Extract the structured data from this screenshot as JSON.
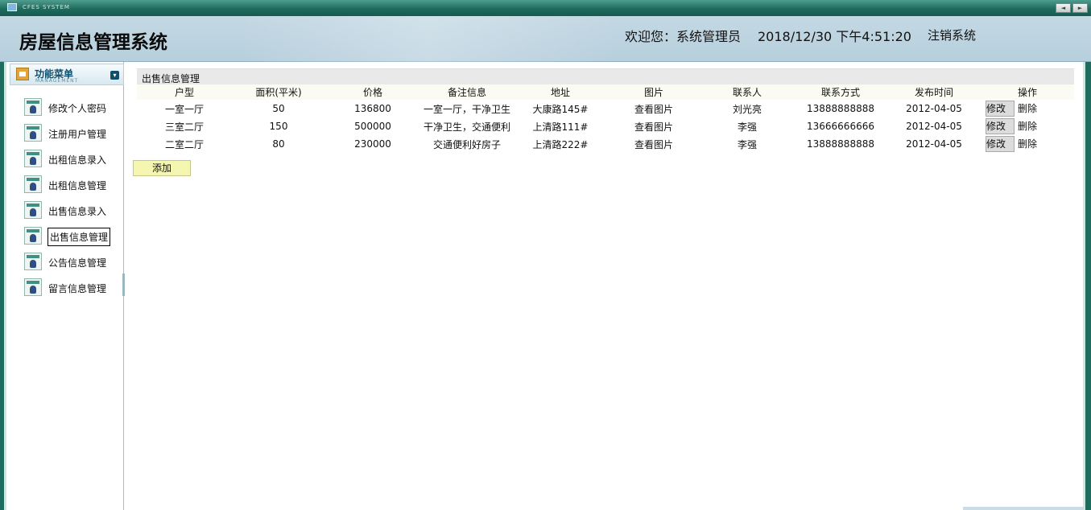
{
  "window": {
    "system_label": "CFES SYSTEM",
    "nav_prev": "◄",
    "nav_next": "►"
  },
  "header": {
    "title": "房屋信息管理系统",
    "welcome": "欢迎您：系统管理员",
    "datetime": "2018/12/30 下午4:51:20",
    "logout": "注销系统"
  },
  "sidebar": {
    "title": "功能菜单",
    "subtitle": "MANAGEMENT",
    "collapse_glyph": "▾",
    "items": [
      {
        "label": "修改个人密码"
      },
      {
        "label": "注册用户管理"
      },
      {
        "label": "出租信息录入"
      },
      {
        "label": "出租信息管理"
      },
      {
        "label": "出售信息录入"
      },
      {
        "label": "出售信息管理",
        "active": true
      },
      {
        "label": "公告信息管理"
      },
      {
        "label": "留言信息管理"
      }
    ]
  },
  "main": {
    "panel_title": "出售信息管理",
    "columns": [
      "户型",
      "面积(平米)",
      "价格",
      "备注信息",
      "地址",
      "图片",
      "联系人",
      "联系方式",
      "发布时间",
      "操作"
    ],
    "rows": [
      {
        "type": "一室一厅",
        "area": "50",
        "price": "136800",
        "note": "一室一厅，干净卫生",
        "address": "大康路145#",
        "image": "查看图片",
        "contact": "刘光亮",
        "phone": "13888888888",
        "date": "2012-04-05"
      },
      {
        "type": "三室二厅",
        "area": "150",
        "price": "500000",
        "note": "干净卫生，交通便利",
        "address": "上清路111#",
        "image": "查看图片",
        "contact": "李强",
        "phone": "13666666666",
        "date": "2012-04-05"
      },
      {
        "type": "二室二厅",
        "area": "80",
        "price": "230000",
        "note": "交通便利好房子",
        "address": "上清路222#",
        "image": "查看图片",
        "contact": "李强",
        "phone": "13888888888",
        "date": "2012-04-05"
      }
    ],
    "edit_label": "修改",
    "delete_label": "删除",
    "add_label": "添加"
  },
  "colors": {
    "frame_green": "#1d6c5e",
    "header_blue": "#c3d8e3",
    "add_button_yellow": "#f5f7b0"
  }
}
